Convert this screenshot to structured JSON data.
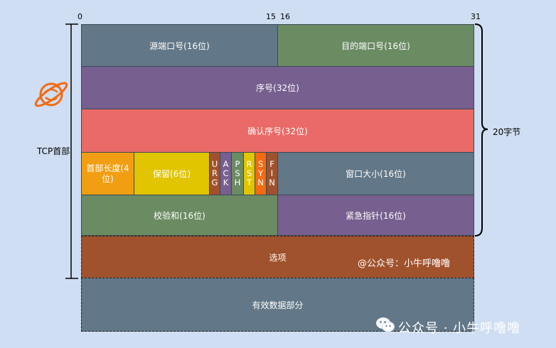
{
  "bit_labels": {
    "b0": "0",
    "b15": "15",
    "b16": "16",
    "b31": "31"
  },
  "rows": {
    "src_port": "源端口号(16位)",
    "dst_port": "目的端口号(16位)",
    "seq": "序号(32位)",
    "ack_num": "确认序号(32位)",
    "header_len": "首部长度(4位)",
    "reserved": "保留(6位)",
    "flags": [
      {
        "letters": [
          "U",
          "R",
          "G"
        ]
      },
      {
        "letters": [
          "A",
          "C",
          "K"
        ]
      },
      {
        "letters": [
          "P",
          "S",
          "H"
        ]
      },
      {
        "letters": [
          "R",
          "S",
          "T"
        ]
      },
      {
        "letters": [
          "S",
          "Y",
          "N"
        ]
      },
      {
        "letters": [
          "F",
          "I",
          "N"
        ]
      }
    ],
    "window": "窗口大小(16位)",
    "checksum": "校验和(16位)",
    "urgent": "紧急指针(16位)",
    "options": "选项",
    "data": "有效数据部分"
  },
  "left_label": "TCP首部",
  "right_label": "20字节",
  "watermark_inner": "@公众号：小牛呼噜噜",
  "watermark_footer": "公众号 · 小牛呼噜噜",
  "colors": {
    "slate": "#627787",
    "green": "#6b8b63",
    "purple": "#775f8f",
    "red": "#e96a66",
    "orange": "#f29e12",
    "yellow": "#e1c500",
    "brown": "#a0522d",
    "background": "#cfdef2"
  }
}
